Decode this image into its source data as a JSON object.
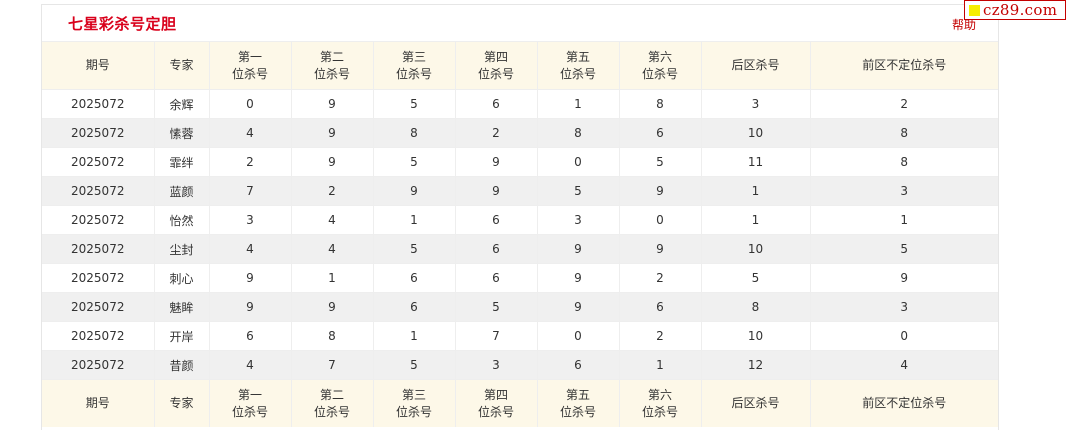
{
  "header": {
    "title": "七星彩杀号定胆",
    "help": "帮助"
  },
  "logo": {
    "text": "cz89.com",
    "mark_color": "#f6ee00",
    "text_color": "#c40000"
  },
  "columns": [
    {
      "line1": "期号",
      "line2": ""
    },
    {
      "line1": "专家",
      "line2": ""
    },
    {
      "line1": "第一",
      "line2": "位杀号"
    },
    {
      "line1": "第二",
      "line2": "位杀号"
    },
    {
      "line1": "第三",
      "line2": "位杀号"
    },
    {
      "line1": "第四",
      "line2": "位杀号"
    },
    {
      "line1": "第五",
      "line2": "位杀号"
    },
    {
      "line1": "第六",
      "line2": "位杀号"
    },
    {
      "line1": "后区杀号",
      "line2": ""
    },
    {
      "line1": "前区不定位杀号",
      "line2": ""
    }
  ],
  "rows": [
    [
      "2025072",
      "余辉",
      "0",
      "9",
      "5",
      "6",
      "1",
      "8",
      "3",
      "2"
    ],
    [
      "2025072",
      "愫蓉",
      "4",
      "9",
      "8",
      "2",
      "8",
      "6",
      "10",
      "8"
    ],
    [
      "2025072",
      "霏绊",
      "2",
      "9",
      "5",
      "9",
      "0",
      "5",
      "11",
      "8"
    ],
    [
      "2025072",
      "蓝颜",
      "7",
      "2",
      "9",
      "9",
      "5",
      "9",
      "1",
      "3"
    ],
    [
      "2025072",
      "怡然",
      "3",
      "4",
      "1",
      "6",
      "3",
      "0",
      "1",
      "1"
    ],
    [
      "2025072",
      "尘封",
      "4",
      "4",
      "5",
      "6",
      "9",
      "9",
      "10",
      "5"
    ],
    [
      "2025072",
      "刺心",
      "9",
      "1",
      "6",
      "6",
      "9",
      "2",
      "5",
      "9"
    ],
    [
      "2025072",
      "魅眸",
      "9",
      "9",
      "6",
      "5",
      "9",
      "6",
      "8",
      "3"
    ],
    [
      "2025072",
      "开岸",
      "6",
      "8",
      "1",
      "7",
      "0",
      "2",
      "10",
      "0"
    ],
    [
      "2025072",
      "昔颜",
      "4",
      "7",
      "5",
      "3",
      "6",
      "1",
      "12",
      "4"
    ]
  ],
  "colors": {
    "title": "#d9001b",
    "header_bg": "#fdf8e8",
    "stripe_bg": "#f0f0f0"
  }
}
